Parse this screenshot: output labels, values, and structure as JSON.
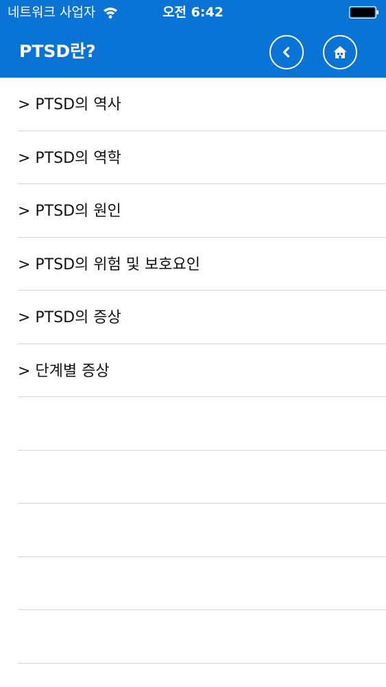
{
  "status_bar": {
    "carrier": "네트워크 사업자",
    "time": "오전 6:42"
  },
  "nav": {
    "title": "PTSD란?",
    "back_icon": "chevron-left-icon",
    "home_icon": "home-icon"
  },
  "menu": {
    "items": [
      {
        "label": "> PTSD의 역사"
      },
      {
        "label": "> PTSD의 역학"
      },
      {
        "label": "> PTSD의 원인"
      },
      {
        "label": "> PTSD의 위험 및 보호요인"
      },
      {
        "label": "> PTSD의 증상"
      },
      {
        "label": "> 단계별 증상"
      },
      {
        "label": ""
      },
      {
        "label": ""
      },
      {
        "label": ""
      },
      {
        "label": ""
      },
      {
        "label": ""
      }
    ]
  },
  "colors": {
    "header": "#0a74d6",
    "separator": "#d6d6d6"
  }
}
